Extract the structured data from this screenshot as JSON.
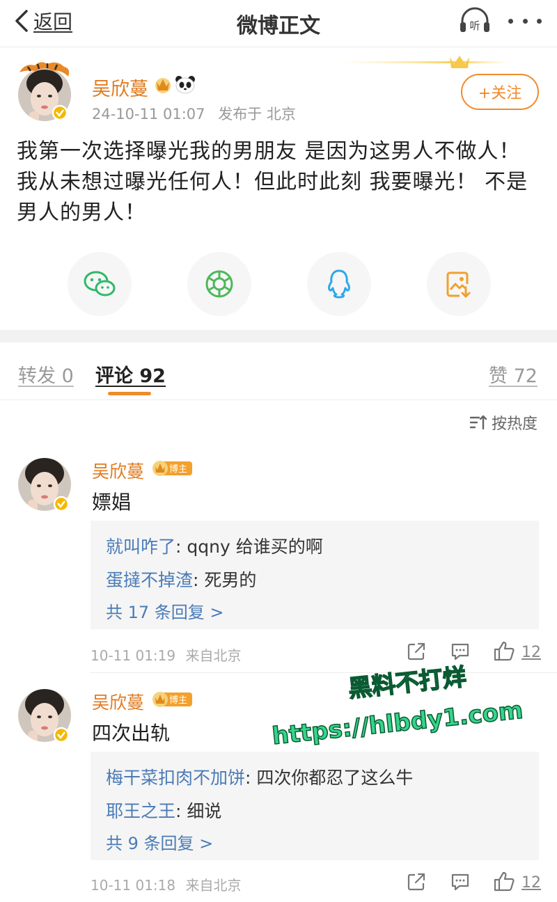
{
  "nav": {
    "back_label": "返回",
    "title": "微博正文",
    "listen_label": "听"
  },
  "post": {
    "author": "吴欣蔓",
    "timestamp": "24-10-11 01:07",
    "location": "发布于 北京",
    "follow_label": "+关注",
    "text": "我第一次选择曝光我的男朋友 是因为这男人不做人！ 我从未想过曝光任何人！但此时此刻 我要曝光！ 不是男人的男人！"
  },
  "share": {
    "icons": [
      "wechat-icon",
      "moments-icon",
      "qq-icon",
      "save-image-icon"
    ],
    "colors": [
      "#2fb86b",
      "#4cb85a",
      "#2da8e8",
      "#f0a030"
    ]
  },
  "tabs": {
    "repost": "转发 0",
    "comment": "评论 92",
    "like": "赞 72"
  },
  "sort": {
    "label": "按热度"
  },
  "comments": [
    {
      "author": "吴欣蔓",
      "badge": "博主",
      "text": "嫖娼",
      "replies": [
        {
          "user": "就叫咋了",
          "text": ": qqny 给谁买的啊"
        },
        {
          "user": "蛋撻不掉渣",
          "text": ": 死男的"
        }
      ],
      "more_replies": "共 17 条回复 >",
      "time": "10-11 01:19",
      "source": "来自北京",
      "likes": "12"
    },
    {
      "author": "吴欣蔓",
      "badge": "博主",
      "text": "四次出轨",
      "replies": [
        {
          "user": "梅干菜扣肉不加饼",
          "text": ": 四次你都忍了这么牛"
        },
        {
          "user": "耶王之王",
          "text": ": 细说"
        }
      ],
      "more_replies": "共 9 条回复 >",
      "time": "10-11 01:18",
      "source": "来自北京",
      "likes": "12"
    }
  ],
  "watermark": {
    "line1": "黑料不打烊",
    "line2": "https://hlbdy1.com",
    "color": "#35d58a"
  },
  "colors": {
    "accent": "#f08a2a",
    "author": "#e07a1f",
    "link": "#4a7bb7",
    "verified": "#f5b800"
  }
}
